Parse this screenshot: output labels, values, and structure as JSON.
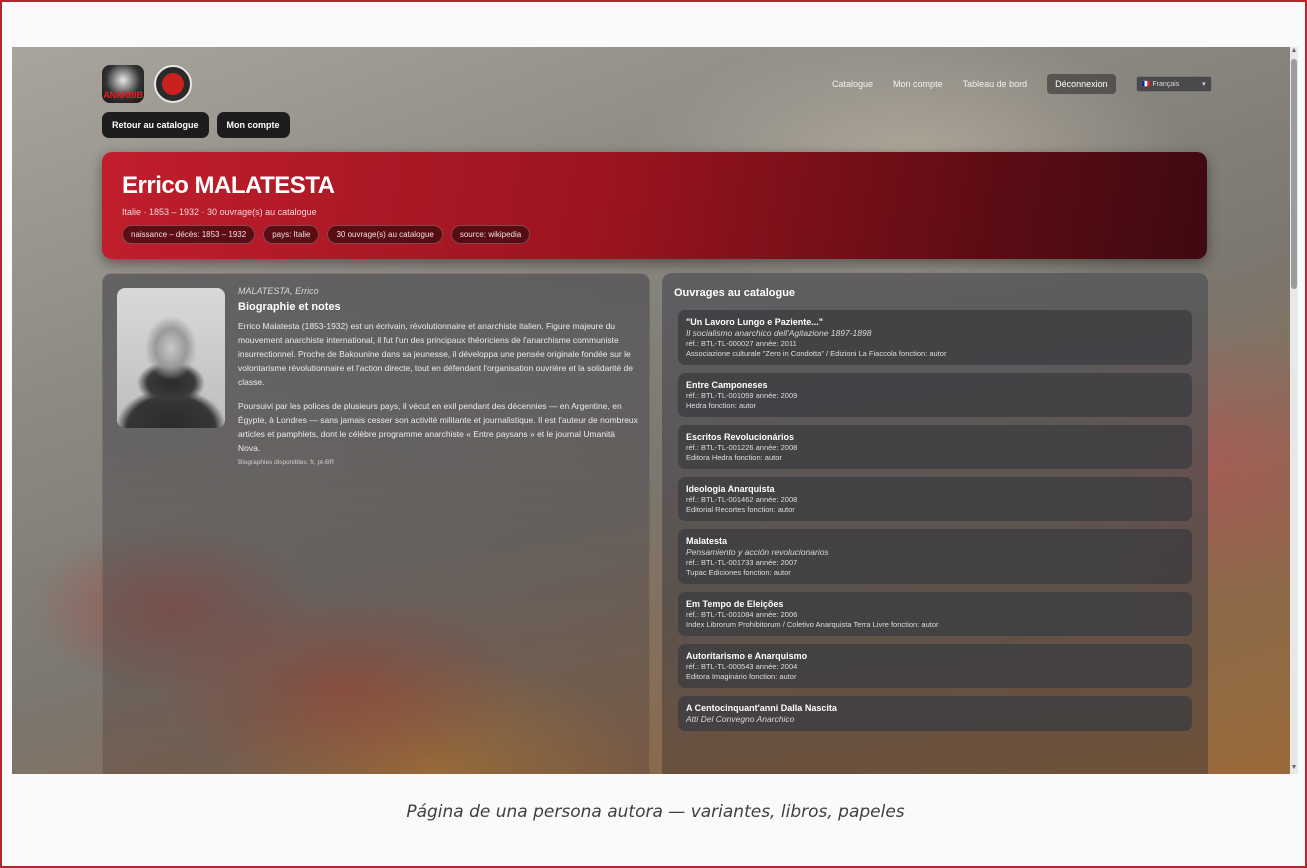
{
  "header": {
    "logo1_text": "ANARBIB",
    "nav": [
      "Catalogue",
      "Mon compte",
      "Tableau de bord"
    ],
    "logout": "Déconnexion",
    "lang_selected": "Français",
    "lang_flag": "🇫🇷",
    "back_button": "Retour au catalogue",
    "account_button": "Mon compte"
  },
  "hero": {
    "name": "Errico MALATESTA",
    "meta": "Italie · 1853 – 1932 · 30 ouvrage(s) au catalogue",
    "chips": [
      "naissance – décès: 1853 – 1932",
      "pays: Italie",
      "30 ouvrage(s) au catalogue",
      "source: wikipedia"
    ]
  },
  "bio": {
    "variant": "MALATESTA, Errico",
    "heading": "Biographie et notes",
    "p1": "Errico Malatesta (1853-1932) est un écrivain, révolutionnaire et anarchiste italien. Figure majeure du mouvement anarchiste international, il fut l'un des principaux théoriciens de l'anarchisme communiste insurrectionnel. Proche de Bakounine dans sa jeunesse, il développa une pensée originale fondée sur le volontarisme révolutionnaire et l'action directe, tout en défendant l'organisation ouvrière et la solidarité de classe.",
    "p2": "Poursuivi par les polices de plusieurs pays, il vécut en exil pendant des décennies — en Argentine, en Égypte, à Londres — sans jamais cesser son activité militante et journalistique. Il est l'auteur de nombreux articles et pamphlets, dont le célèbre programme anarchiste « Entre paysans » et le journal Umanità Nova.",
    "available": "Biographies disponibles: fr, pt-BR"
  },
  "works": {
    "title": "Ouvrages au catalogue",
    "items": [
      {
        "title": "\"Un Lavoro Lungo e Paziente...\"",
        "subtitle": "Il socialismo anarchico dell'Agitazione 1897-1898",
        "ref": "réf.: BTL-TL-000027   année: 2011",
        "pub": "Associazione culturale \"Zero in Condotta\" / Edizioni La Fiaccola   fonction: autor"
      },
      {
        "title": "Entre Camponeses",
        "subtitle": "",
        "ref": "réf.: BTL-TL-001059   année: 2009",
        "pub": "Hedra   fonction: autor"
      },
      {
        "title": "Escritos Revolucionários",
        "subtitle": "",
        "ref": "réf.: BTL-TL-001226   année: 2008",
        "pub": "Editora Hedra   fonction: autor"
      },
      {
        "title": "Ideologia Anarquista",
        "subtitle": "",
        "ref": "réf.: BTL-TL-001462   année: 2008",
        "pub": "Editorial Recortes   fonction: autor"
      },
      {
        "title": "Malatesta",
        "subtitle": "Pensamiento y acción revolucionarios",
        "ref": "réf.: BTL-TL-001733   année: 2007",
        "pub": "Tupac Ediciones   fonction: autor"
      },
      {
        "title": "Em Tempo de Eleições",
        "subtitle": "",
        "ref": "réf.: BTL-TL-001084   année: 2006",
        "pub": "Index Librorum Prohibitorum / Coletivo Anarquista Terra Livre   fonction: autor"
      },
      {
        "title": "Autoritarismo e Anarquismo",
        "subtitle": "",
        "ref": "réf.: BTL-TL-000543   année: 2004",
        "pub": "Editora Imaginário   fonction: autor"
      },
      {
        "title": "A Centocinquant'anni Dalla Nascita",
        "subtitle": "Atti Del Convegno Anarchico",
        "ref": "",
        "pub": ""
      }
    ]
  },
  "caption": "Página de una persona autora — variantes, libros, papeles",
  "colors": {
    "hero_red": "#c11e2c",
    "frame_border": "#b3262b"
  }
}
